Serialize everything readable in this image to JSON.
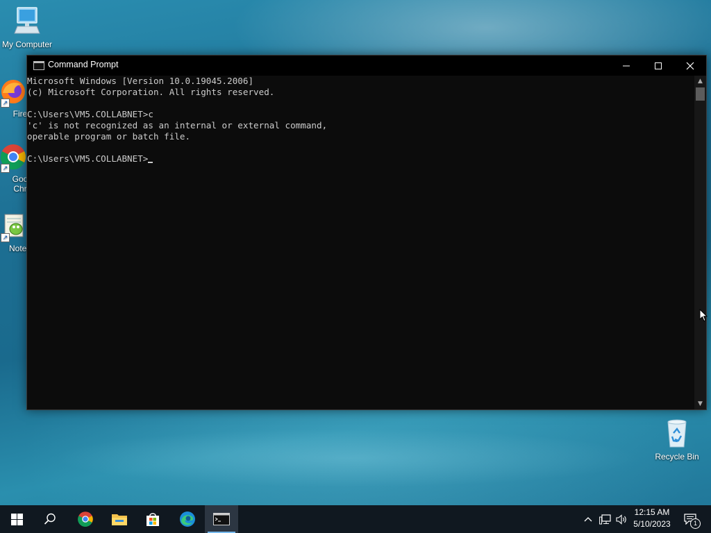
{
  "desktop": {
    "icons": [
      {
        "label": "My Computer"
      },
      {
        "label": "Fire"
      },
      {
        "label": "Goo"
      },
      {
        "label": "Chr"
      },
      {
        "label": "Notep"
      },
      {
        "label": "Recycle Bin"
      }
    ]
  },
  "window": {
    "title": "Command Prompt",
    "minimize_glyph": "—",
    "maximize_glyph": "☐",
    "close_glyph": "✕",
    "console_lines": [
      "Microsoft Windows [Version 10.0.19045.2006]",
      "(c) Microsoft Corporation. All rights reserved.",
      "",
      "C:\\Users\\VM5.COLLABNET>c",
      "'c' is not recognized as an internal or external command,",
      "operable program or batch file.",
      "",
      "C:\\Users\\VM5.COLLABNET>"
    ]
  },
  "taskbar": {
    "items": [
      {
        "icon": "windows-start-icon"
      },
      {
        "icon": "search-icon"
      },
      {
        "icon": "chrome-icon"
      },
      {
        "icon": "file-explorer-icon"
      },
      {
        "icon": "microsoft-store-icon"
      },
      {
        "icon": "edge-icon"
      },
      {
        "icon": "command-prompt-icon",
        "active": true
      }
    ],
    "tray": {
      "time": "12:15 AM",
      "date": "5/10/2023",
      "notification_count": "1"
    }
  },
  "colors": {
    "console_bg": "#0c0c0c",
    "console_fg": "#cccccc",
    "taskbar_bg": "#101820",
    "accent": "#76b9ed"
  }
}
